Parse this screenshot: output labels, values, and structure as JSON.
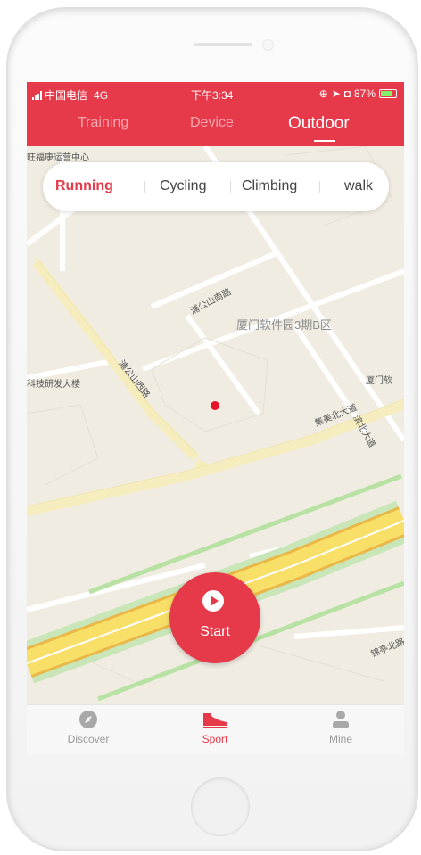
{
  "status": {
    "carrier": "中国电信",
    "network": "4G",
    "time": "下午3:34",
    "battery": "87%"
  },
  "tabs": [
    {
      "label": "Training",
      "active": false
    },
    {
      "label": "Device",
      "active": false
    },
    {
      "label": "Outdoor",
      "active": true
    }
  ],
  "activity_types": [
    {
      "label": "Running",
      "active": true
    },
    {
      "label": "Cycling",
      "active": false
    },
    {
      "label": "Climbing",
      "active": false
    },
    {
      "label": "walk",
      "active": false
    }
  ],
  "map": {
    "labels": [
      "旺福康运营中心",
      "厦门软件园3期B区",
      "科技研发大楼",
      "厦门软",
      "集美北大道",
      "浦公山西路",
      "浦公山南路",
      "滨北大道",
      "锦亭北路"
    ],
    "location_dot_color": "#e8122a"
  },
  "start_button": {
    "label": "Start"
  },
  "bottom_nav": [
    {
      "label": "Discover",
      "icon": "compass-icon",
      "active": false
    },
    {
      "label": "Sport",
      "icon": "sneaker-icon",
      "active": true
    },
    {
      "label": "Mine",
      "icon": "person-icon",
      "active": false
    }
  ],
  "colors": {
    "accent": "#e63a4a",
    "map_bg": "#f1ece2",
    "highway": "#f6d95a"
  }
}
